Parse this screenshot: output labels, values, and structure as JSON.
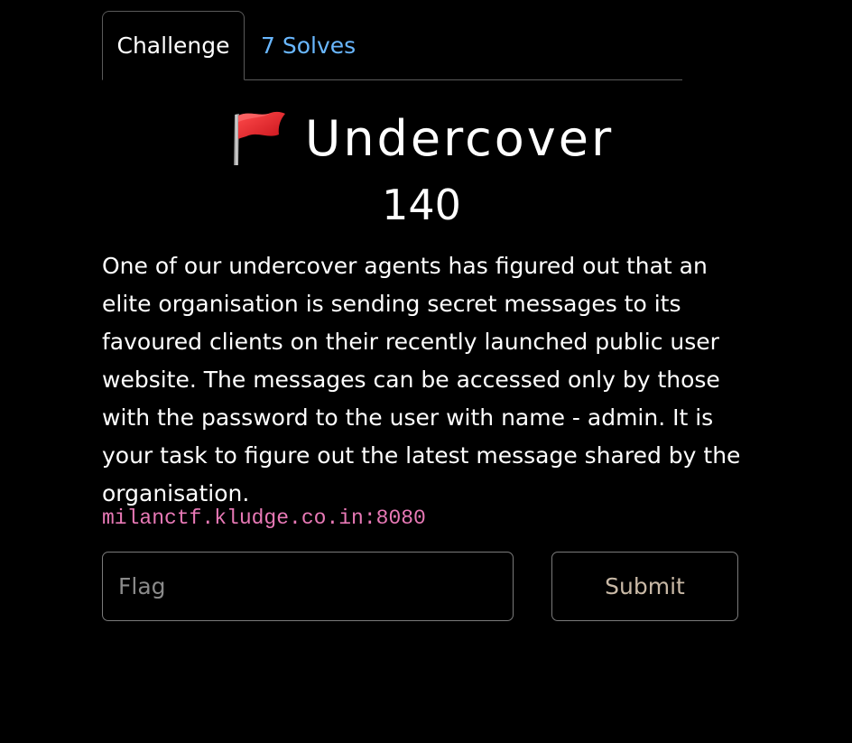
{
  "tabs": {
    "challenge_label": "Challenge",
    "solves_label": "7 Solves"
  },
  "challenge": {
    "icon": "red-flag-icon",
    "name": "Undercover",
    "points": "140",
    "description": "One of our undercover agents has figured out that an elite organisation is sending secret messages to its favoured clients on their recently launched public user website. The messages can be accessed only by those with the password to the user with name - admin. It is your task to figure out the latest message shared by the organisation.",
    "connection_info": "milanctf.kludge.co.in:8080"
  },
  "form": {
    "flag_placeholder": "Flag",
    "flag_value": "",
    "submit_label": "Submit"
  },
  "colors": {
    "background": "#000000",
    "solves_link": "#69b7ff",
    "connection_text": "#e879b6",
    "submit_text": "#c9b9a6",
    "flag_red": "#e8232c"
  }
}
